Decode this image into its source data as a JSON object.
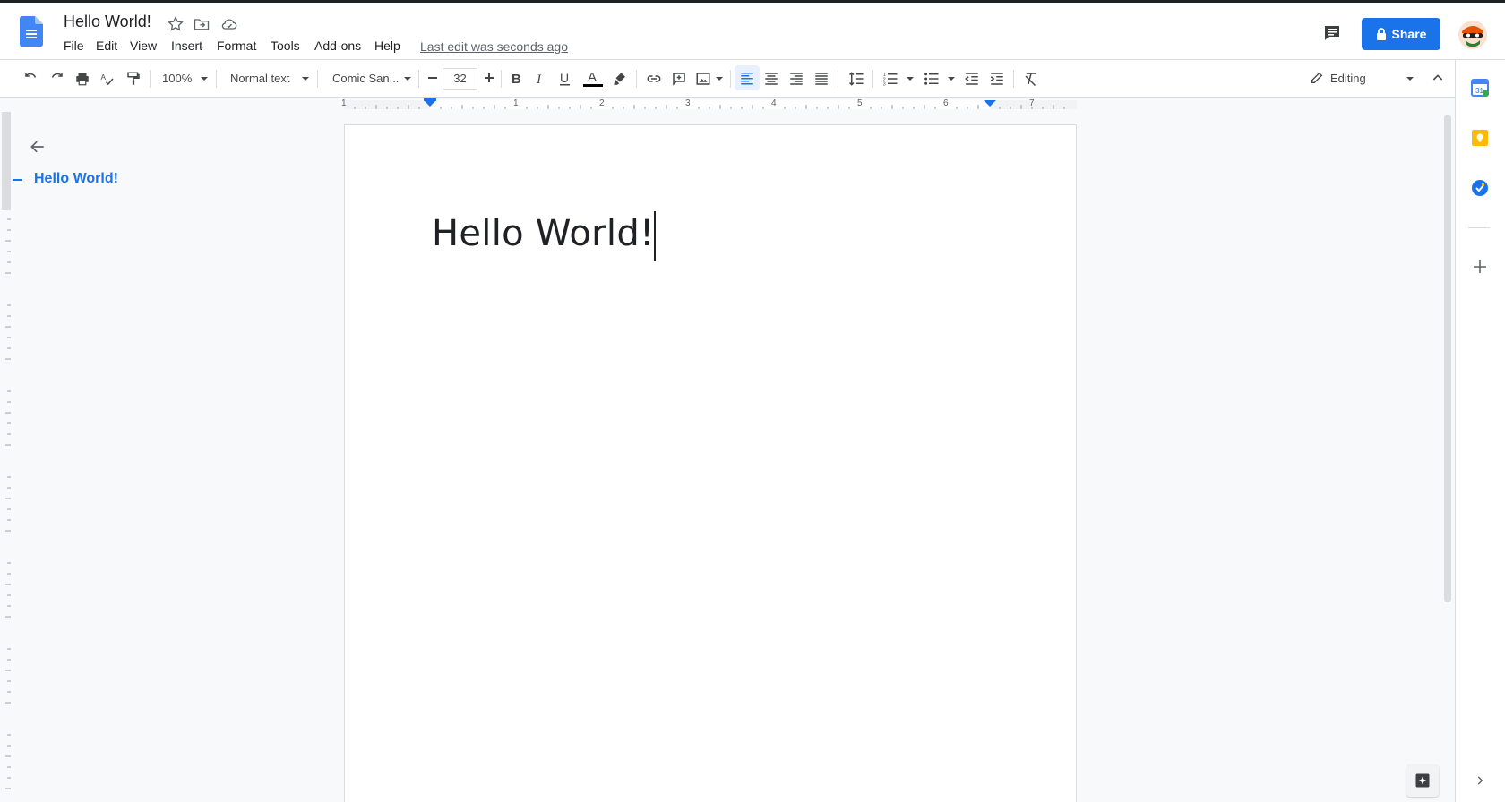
{
  "header": {
    "title": "Hello World!",
    "menus": [
      "File",
      "Edit",
      "View",
      "Insert",
      "Format",
      "Tools",
      "Add-ons",
      "Help"
    ],
    "last_edit": "Last edit was seconds ago",
    "share_label": "Share"
  },
  "toolbar": {
    "zoom": "100%",
    "style": "Normal text",
    "font": "Comic San...",
    "font_size": "32",
    "mode": "Editing"
  },
  "ruler": {
    "labels": [
      "1",
      "1",
      "2",
      "3",
      "4",
      "5",
      "6",
      "7"
    ]
  },
  "outline": {
    "items": [
      "Hello World!"
    ]
  },
  "document": {
    "text": "Hello World!"
  },
  "colors": {
    "accent": "#1a73e8",
    "share_bg": "#1a73e8"
  },
  "icons": {
    "doc_logo": "google-docs-icon",
    "star": "star-icon",
    "move": "folder-move-icon",
    "cloud": "cloud-status-icon",
    "comments": "comment-icon",
    "lock": "lock-icon"
  }
}
